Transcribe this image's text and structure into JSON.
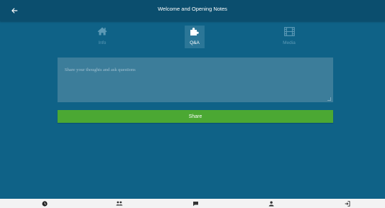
{
  "header": {
    "title": "Welcome and Opening Notes",
    "back_icon": "arrow-left-icon"
  },
  "tabs": [
    {
      "label": "Info",
      "icon": "home-icon",
      "active": false
    },
    {
      "label": "Q&A",
      "icon": "puzzle-icon",
      "active": true
    },
    {
      "label": "Media",
      "icon": "film-icon",
      "active": false
    }
  ],
  "qa": {
    "placeholder": "Share your thoughts and ask questions",
    "value": "",
    "share_label": "Share"
  },
  "bottom_nav": [
    {
      "icon": "clock-icon"
    },
    {
      "icon": "people-icon"
    },
    {
      "icon": "chat-icon"
    },
    {
      "icon": "person-icon"
    },
    {
      "icon": "logout-icon"
    }
  ],
  "colors": {
    "background": "#0f6287",
    "topbar": "#0b4e6e",
    "input": "#3c7d9a",
    "share_button": "#4ba833",
    "active_tab": "#2b7697",
    "bottom_bar": "#f3f3f3"
  }
}
